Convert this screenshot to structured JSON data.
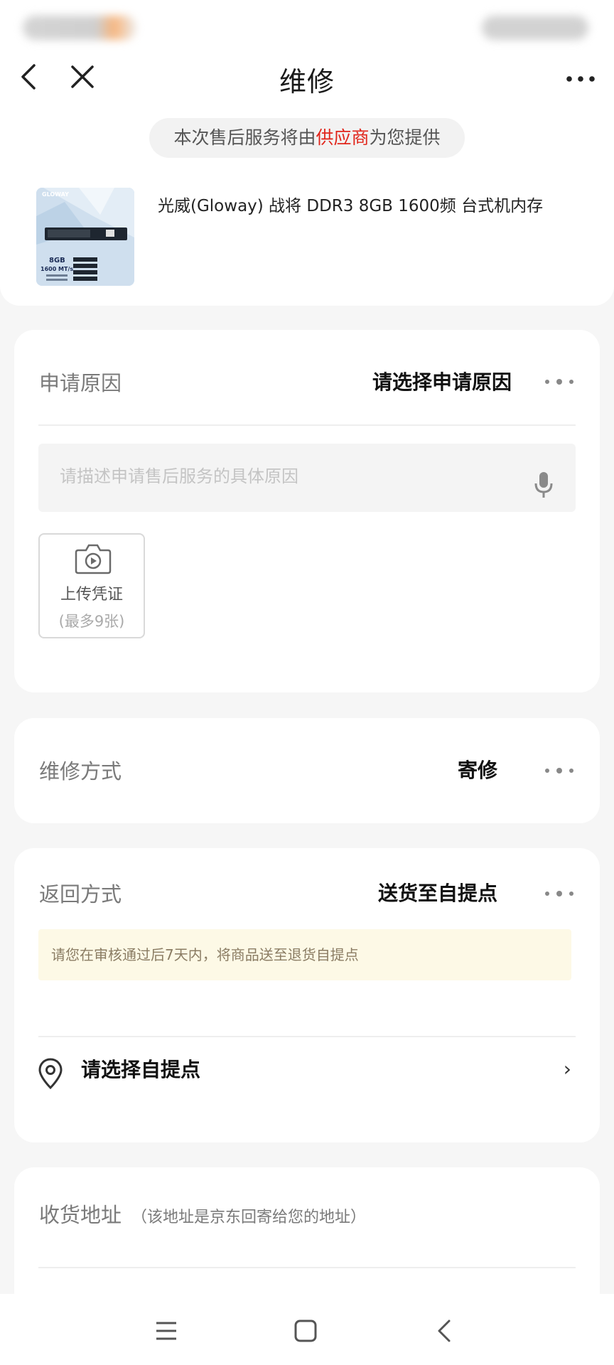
{
  "header": {
    "title": "维修",
    "supplier_notice_before": "本次售后服务将由",
    "supplier_notice_highlight": "供应商",
    "supplier_notice_after": "为您提供"
  },
  "product": {
    "title": "光威(Gloway) 战将 DDR3 8GB 1600频 台式机内存",
    "image_brand": "GLOWAY",
    "image_capacity": "8GB",
    "image_speed": "1600 MT/s"
  },
  "reason_card": {
    "label": "申请原因",
    "value": "请选择申请原因",
    "placeholder": "请描述申请售后服务的具体原因",
    "upload_label": "上传凭证",
    "upload_limit": "(最多9张)"
  },
  "repair_card": {
    "label": "维修方式",
    "value": "寄修"
  },
  "return_card": {
    "label": "返回方式",
    "value": "送货至自提点",
    "notice": "请您在审核通过后7天内，将商品送至退货自提点",
    "pickup_label": "请选择自提点",
    "chevron": "›"
  },
  "address_card": {
    "label": "收货地址",
    "note": "（该地址是京东回寄给您的地址）"
  },
  "colors": {
    "accent_red": "#e1251b",
    "notice_bg": "#fdf9e6",
    "page_bg": "#f6f6f6"
  },
  "icons": [
    "back-arrow-icon",
    "close-icon",
    "more-icon",
    "mic-icon",
    "camera-icon",
    "location-pin-icon",
    "menu-icon",
    "home-icon",
    "nav-back-icon"
  ]
}
